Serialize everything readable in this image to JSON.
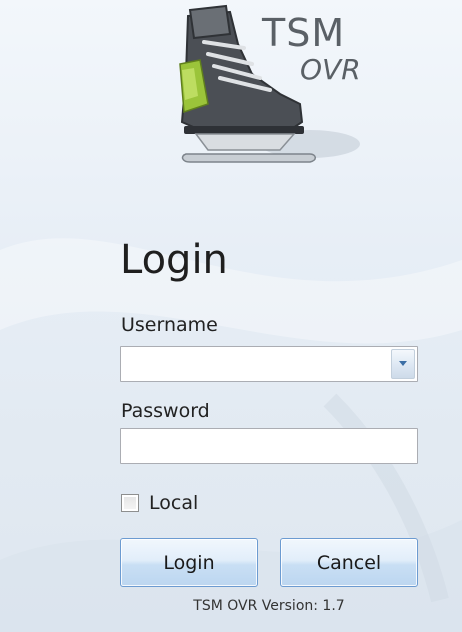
{
  "logo": {
    "line1": "TSM",
    "line2": "OVR"
  },
  "heading": "Login",
  "username": {
    "label": "Username",
    "value": "",
    "placeholder": ""
  },
  "password": {
    "label": "Password",
    "value": "",
    "placeholder": ""
  },
  "local": {
    "label": "Local",
    "checked": false
  },
  "buttons": {
    "login": "Login",
    "cancel": "Cancel"
  },
  "footer": {
    "version": "TSM OVR Version: 1.7"
  },
  "icons": {
    "logo": "ice-skate-icon",
    "dropdown": "chevron-down-icon"
  },
  "colors": {
    "button_border": "#6c9bd1",
    "skate_accent": "#9bc43a",
    "background": "#e7eef6"
  }
}
